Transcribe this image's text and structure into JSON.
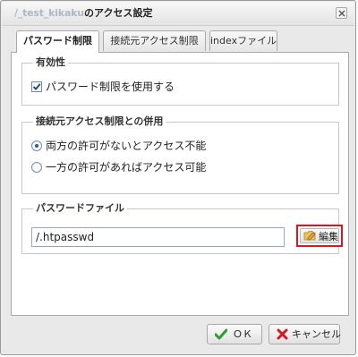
{
  "window": {
    "title_path": "/_test_kikaku",
    "title_suffix": "のアクセス設定"
  },
  "tabs": [
    {
      "label": "パスワード制限",
      "active": true
    },
    {
      "label": "接続元アクセス制限",
      "active": false
    },
    {
      "label": "indexファイル",
      "active": false
    }
  ],
  "validity": {
    "legend": "有効性",
    "checkbox_label": "パスワード制限を使用する",
    "checked": true
  },
  "combined": {
    "legend": "接続元アクセス制限との併用",
    "options": [
      {
        "label": "両方の許可がないとアクセス不能",
        "selected": true
      },
      {
        "label": "一方の許可があればアクセス可能",
        "selected": false
      }
    ]
  },
  "password_file": {
    "legend": "パスワードファイル",
    "value": "/.htpasswd",
    "edit_label": "編集"
  },
  "footer": {
    "ok_label": "ＯＫ",
    "cancel_label": "キャンセル"
  },
  "colors": {
    "highlight_border": "#e0141e",
    "ok_check": "#2f9a2f",
    "cancel_x": "#d11b1b"
  }
}
